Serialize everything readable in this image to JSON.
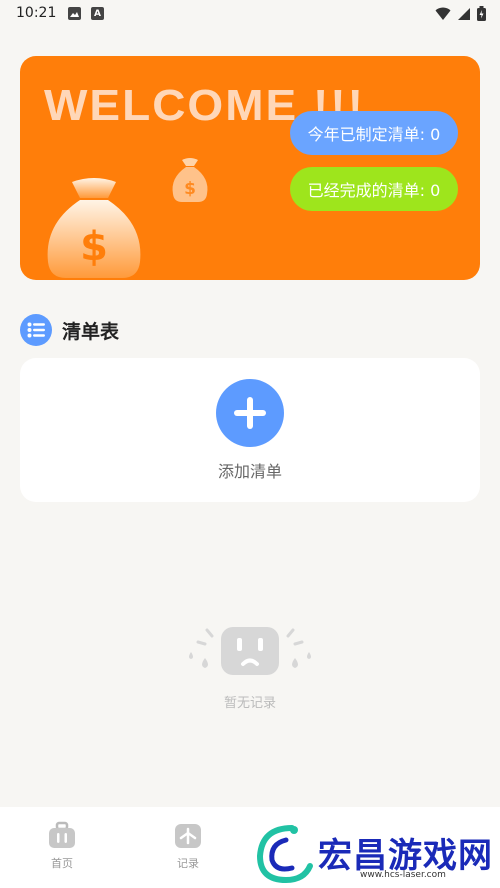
{
  "status_bar": {
    "time": "10:21"
  },
  "banner": {
    "welcome_text": "WELCOME !!!",
    "planned_this_year": "今年已制定清单: 0",
    "completed": "已经完成的清单: 0"
  },
  "section": {
    "title": "清单表"
  },
  "add_card": {
    "label": "添加清单"
  },
  "empty_state": {
    "text": "暂无记录"
  },
  "tabbar": {
    "home_label": "首页",
    "record_label": "记录"
  },
  "watermark": {
    "text": "宏昌游戏网",
    "url": "www.hcs-laser.com"
  },
  "colors": {
    "banner": "#ff7e0a",
    "accent_blue": "#5d9bff",
    "pill_blue": "#6aa4ff",
    "pill_green": "#9ee51c"
  }
}
